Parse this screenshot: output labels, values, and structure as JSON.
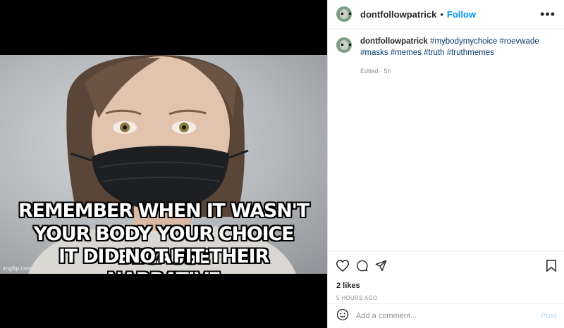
{
  "media": {
    "meme_lines": [
      "REMEMBER WHEN IT WASN'T",
      "YOUR BODY YOUR CHOICE BECAUSE",
      "IT DID NOT FIT THEIR NARRATIVE"
    ],
    "watermark": "imgflip.com"
  },
  "header": {
    "username": "dontfollowpatrick",
    "separator": "•",
    "follow_label": "Follow",
    "more_label": "•••"
  },
  "caption": {
    "username": "dontfollowpatrick",
    "hashtags": "#mybodymychoice #roevwade #masks #memes #truth #truthmemes",
    "edited": "Edited · 5h"
  },
  "actions": {
    "likes": "2 likes",
    "time": "5 HOURS AGO"
  },
  "comment": {
    "placeholder": "Add a comment...",
    "post_label": "Post"
  },
  "icons": [
    "heart-icon",
    "comment-icon",
    "share-icon",
    "bookmark-icon",
    "emoji-icon"
  ],
  "colors": {
    "link": "#0095f6",
    "hashtag": "#00376b",
    "muted": "#8e8e8e",
    "post_disabled": "#b2dffc"
  }
}
